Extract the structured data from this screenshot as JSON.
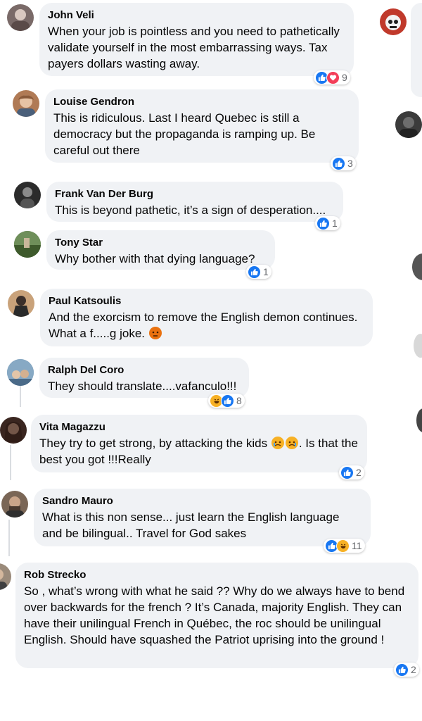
{
  "comments": [
    {
      "name": "John Veli",
      "text": "When your job is pointless and you need to pathetically validate yourself in the most embarrassing ways. Tax payers dollars wasting away.",
      "count": "9"
    },
    {
      "name": "Louise Gendron",
      "text": "This is ridiculous. Last I heard Quebec is still a democracy but the propaganda is ramping up. Be careful out there",
      "count": "3"
    },
    {
      "name": "Frank Van Der Burg",
      "text": "This is beyond pathetic, it’s a sign of desperation....",
      "count": "1"
    },
    {
      "name": "Tony Star",
      "text": "Why bother with that dying language?",
      "count": "1"
    },
    {
      "name": "Paul Katsoulis",
      "text_before": "And the exorcism to remove the English demon continues. What a f.....g joke.",
      "count": ""
    },
    {
      "name": "Ralph Del Coro",
      "text": "They should translate....vafanculo!!!",
      "count": "8"
    },
    {
      "name": "Vita Magazzu",
      "text_before": "They try to get strong, by attacking the kids",
      "text_after": ". Is that the best you got !!!Really",
      "count": "2"
    },
    {
      "name": "Sandro Mauro",
      "text": "What is this non sense... just learn the English language and be bilingual.. Travel for God sakes",
      "count": "11"
    },
    {
      "name": "Rob Strecko",
      "text": "So , what’s wrong with what he said ?? Why do we always have to bend over backwards for the french ? It’s Canada, majority English. They can have their unilingual French in Québec, the roc should be unilingual English. Should have squashed the Patriot uprising into the ground !",
      "count": "2"
    }
  ],
  "colors": {
    "bubble": "#f0f2f5",
    "like": "#1877f2",
    "love": "#f33e58",
    "haha": "#f7b125",
    "angry": "#e9710f"
  }
}
